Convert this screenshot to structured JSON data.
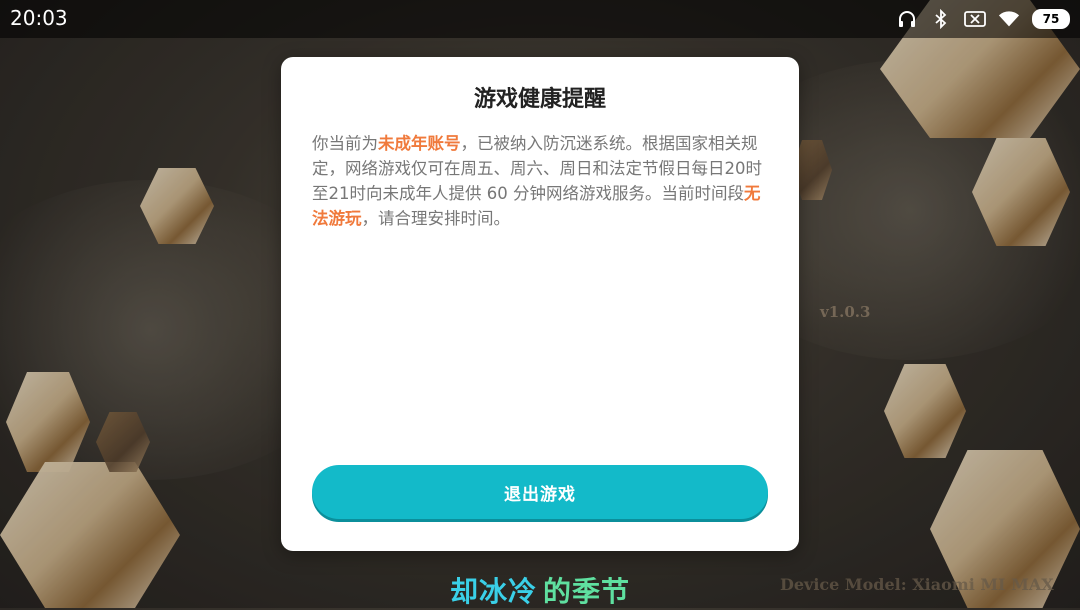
{
  "status_bar": {
    "time": "20:03",
    "icons": [
      "headphones-icon",
      "bluetooth-icon",
      "sim-card-off-icon",
      "wifi-icon"
    ],
    "battery_level": "75"
  },
  "dialog": {
    "title": "游戏健康提醒",
    "body": {
      "prefix": "你当前为",
      "highlight_1": "未成年账号",
      "middle": "，已被纳入防沉迷系统。根据国家相关规定，网络游戏仅可在周五、周六、周日和法定节假日每日20时至21时向未成年人提供 60 分钟网络游戏服务。当前时间段",
      "highlight_2": "无法游玩",
      "suffix": "，请合理安排时间。"
    },
    "exit_button_label": "退出游戏",
    "highlight_color": "#f07a3c",
    "button_color": "#13bac9"
  },
  "background": {
    "version": "v1.0.3",
    "device_model": "Device Model: Xiaomi MI MAX",
    "subtitle_part1": "却冰冷",
    "subtitle_part2": "的季节"
  }
}
